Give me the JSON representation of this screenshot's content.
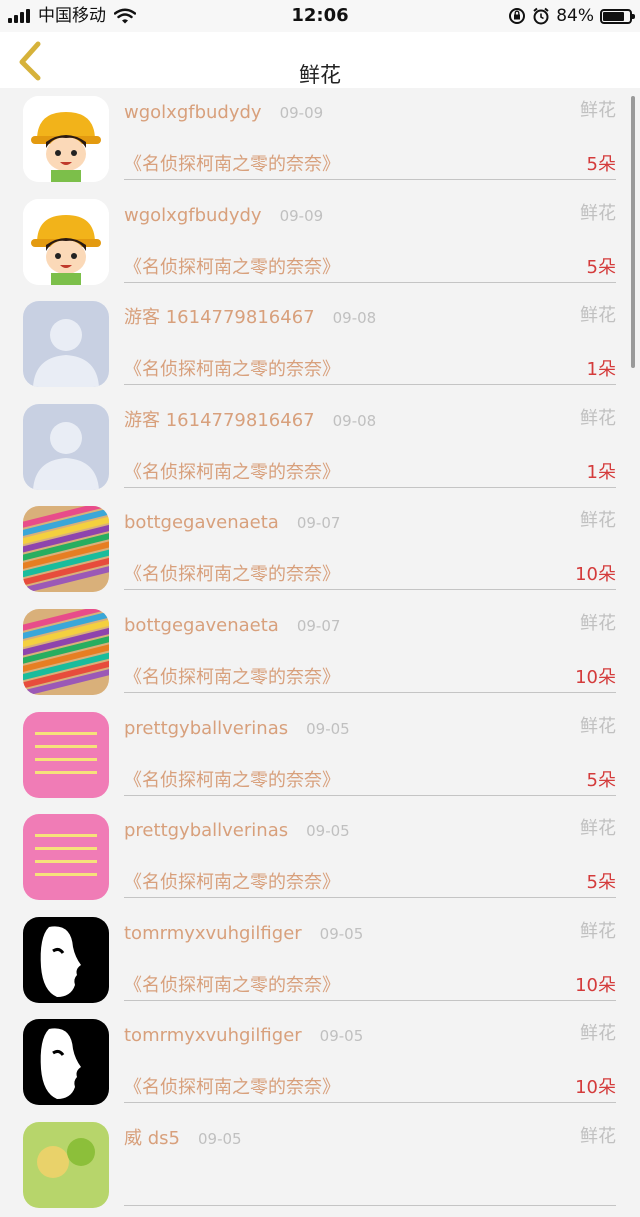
{
  "status_bar": {
    "carrier": "中国移动",
    "time": "12:06",
    "battery_percent": "84%",
    "battery_level": 0.84
  },
  "nav": {
    "title": "鲜花",
    "back_icon": "chevron-left-icon",
    "accent_color": "#d6b23a"
  },
  "colors": {
    "name": "#d8a07c",
    "count": "#d43b3b",
    "muted": "#c0c0c0"
  },
  "gifts": [
    {
      "name": "wgolxgfbudydy",
      "date": "09-09",
      "type": "鲜花",
      "work": "《名侦探柯南之零的奈奈》",
      "count": "5朵",
      "avatar": "cartoon-girl-avatar"
    },
    {
      "name": "wgolxgfbudydy",
      "date": "09-09",
      "type": "鲜花",
      "work": "《名侦探柯南之零的奈奈》",
      "count": "5朵",
      "avatar": "cartoon-girl-avatar"
    },
    {
      "name": "游客 1614779816467",
      "date": "09-08",
      "type": "鲜花",
      "work": "《名侦探柯南之零的奈奈》",
      "count": "1朵",
      "avatar": "default-person-avatar"
    },
    {
      "name": "游客 1614779816467",
      "date": "09-08",
      "type": "鲜花",
      "work": "《名侦探柯南之零的奈奈》",
      "count": "1朵",
      "avatar": "default-person-avatar"
    },
    {
      "name": "bottgegavenaeta",
      "date": "09-07",
      "type": "鲜花",
      "work": "《名侦探柯南之零的奈奈》",
      "count": "10朵",
      "avatar": "colored-pencils-avatar"
    },
    {
      "name": "bottgegavenaeta",
      "date": "09-07",
      "type": "鲜花",
      "work": "《名侦探柯南之零的奈奈》",
      "count": "10朵",
      "avatar": "colored-pencils-avatar"
    },
    {
      "name": "prettgyballverinas",
      "date": "09-05",
      "type": "鲜花",
      "work": "《名侦探柯南之零的奈奈》",
      "count": "5朵",
      "avatar": "pink-text-card-avatar"
    },
    {
      "name": "prettgyballverinas",
      "date": "09-05",
      "type": "鲜花",
      "work": "《名侦探柯南之零的奈奈》",
      "count": "5朵",
      "avatar": "pink-text-card-avatar"
    },
    {
      "name": "tomrmyxvuhgilfiger",
      "date": "09-05",
      "type": "鲜花",
      "work": "《名侦探柯南之零的奈奈》",
      "count": "10朵",
      "avatar": "white-mask-avatar"
    },
    {
      "name": "tomrmyxvuhgilfiger",
      "date": "09-05",
      "type": "鲜花",
      "work": "《名侦探柯南之零的奈奈》",
      "count": "10朵",
      "avatar": "white-mask-avatar"
    },
    {
      "name": "威 ds5",
      "date": "09-05",
      "type": "鲜花",
      "work": "",
      "count": "",
      "avatar": "food-photo-avatar"
    }
  ]
}
